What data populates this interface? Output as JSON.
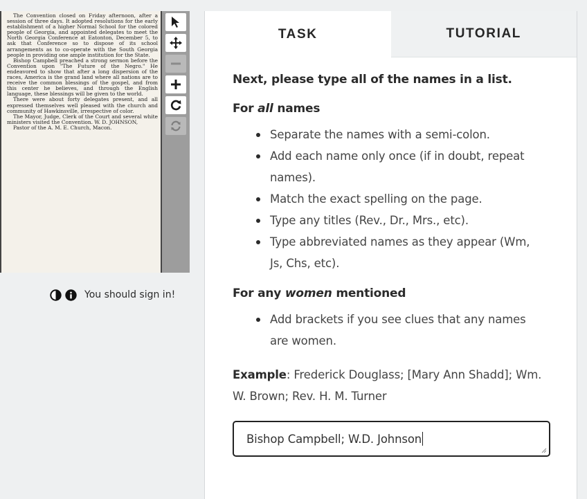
{
  "document": {
    "paragraphs": [
      "The Convention closed on Friday afternoon, after a session of three days. It adopted resolutions for the early establishment of a higher Normal School for the colored people of Georgia, and appointed delegates to meet the North Georgia Conference at Eatonton, December 5, to ask that Conference so to dispose of its school arrangements as to co-operate with the South Georgia people in providing one ample institution for the State.",
      "Bishop Campbell preached a strong sermon before the Convention upon \"The Future of the Negro.\" He endeavored to show that after a long dispersion of the races, America is the grand land where all nations are to receive the common blessings of the gospel, and from this center he believes, and through the English language, these blessings will be given to the world.",
      "There were about forty delegates present, and all expressed themselves well pleased with the church and community of Hawkinsville, irrespective of color.",
      "The Mayor, Judge, Clerk of the Court and several white ministers visited the Convention.          W. D. JOHNSON,"
    ],
    "signature": "Pastor of the A. M. E. Church, Macon."
  },
  "toolbar": {
    "tools": [
      "pointer-icon",
      "move-icon",
      "zoom-out-icon",
      "zoom-in-icon",
      "rotate-icon",
      "reset-icon"
    ]
  },
  "viewer_footer": {
    "signin_text": "You should sign in!"
  },
  "tabs": {
    "task": "TASK",
    "tutorial": "TUTORIAL"
  },
  "task": {
    "instruction": "Next, please type all of the names in a list.",
    "all_names_prefix": "For ",
    "all_names_em": "all",
    "all_names_suffix": " names",
    "all_names_rules": [
      "Separate the names with a semi-colon.",
      "Add each name only once (if in doubt, repeat names).",
      "Match the exact spelling on the page.",
      "Type any titles (Rev., Dr., Mrs., etc).",
      "Type abbreviated names as they appear (Wm, Js, Chs, etc)."
    ],
    "women_prefix": "For any ",
    "women_em": "women",
    "women_suffix": " mentioned",
    "women_rules": [
      "Add brackets if you see clues that any names are women."
    ],
    "example_label": "Example",
    "example_text": ": Frederick Douglass; [Mary Ann Shadd]; Wm. W. Brown; Rev. H. M. Turner",
    "answer_value": "Bishop Campbell; W.D. Johnson"
  },
  "colors": {
    "page_background": "#eef0f1",
    "toolbar_background": "#9d9d9d",
    "inactive_tab": "#eff1f2",
    "text": "#2b2b2b"
  }
}
